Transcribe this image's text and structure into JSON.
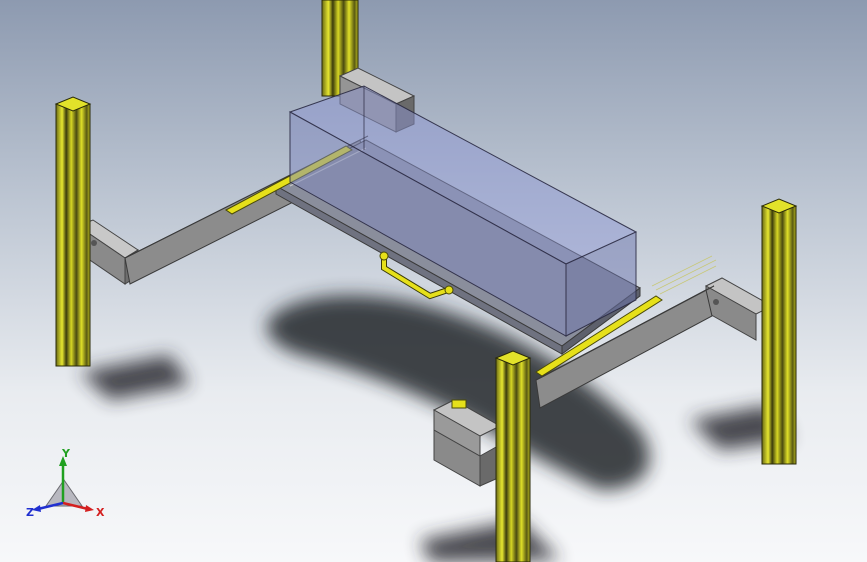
{
  "viewport": {
    "background_top": "#8d9ab0",
    "background_bottom": "#f7f8fa"
  },
  "model": {
    "profile_color": "#c8c81e",
    "profile_dark": "#4a4a10",
    "beam_color": "#7a7a7a",
    "tray_color": "#8a8e9c",
    "box_color": "#7a86c8",
    "handle_color": "#e6e01a"
  },
  "triad": {
    "x_label": "X",
    "y_label": "Y",
    "z_label": "Z",
    "x_color": "#d42020",
    "y_color": "#20a020",
    "z_color": "#2030d0"
  }
}
